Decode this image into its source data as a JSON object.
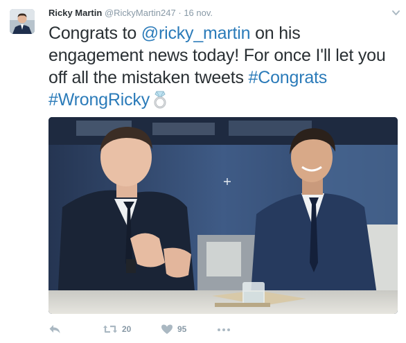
{
  "tweet": {
    "author": {
      "name": "Ricky Martin",
      "handle": "@RickyMartin247"
    },
    "separator": "·",
    "timestamp": "16 nov.",
    "text": {
      "part1": "Congrats to ",
      "mention": "@ricky_martin",
      "part2": " on his engagement news today! For once I'll let you off all the mistaken tweets ",
      "hashtag1": "#Congrats",
      "space": " ",
      "hashtag2": "#WrongRicky"
    },
    "emoji": "ring-emoji",
    "media": "photo of two men in suits seated at a table",
    "actions": {
      "retweet_count": "20",
      "like_count": "95"
    }
  },
  "colors": {
    "text": "#292f33",
    "secondary": "#8899a6",
    "link": "#2b7bb9"
  },
  "icons": [
    "reply-icon",
    "retweet-icon",
    "like-icon",
    "more-icon",
    "caret-down-icon",
    "ring-emoji"
  ]
}
